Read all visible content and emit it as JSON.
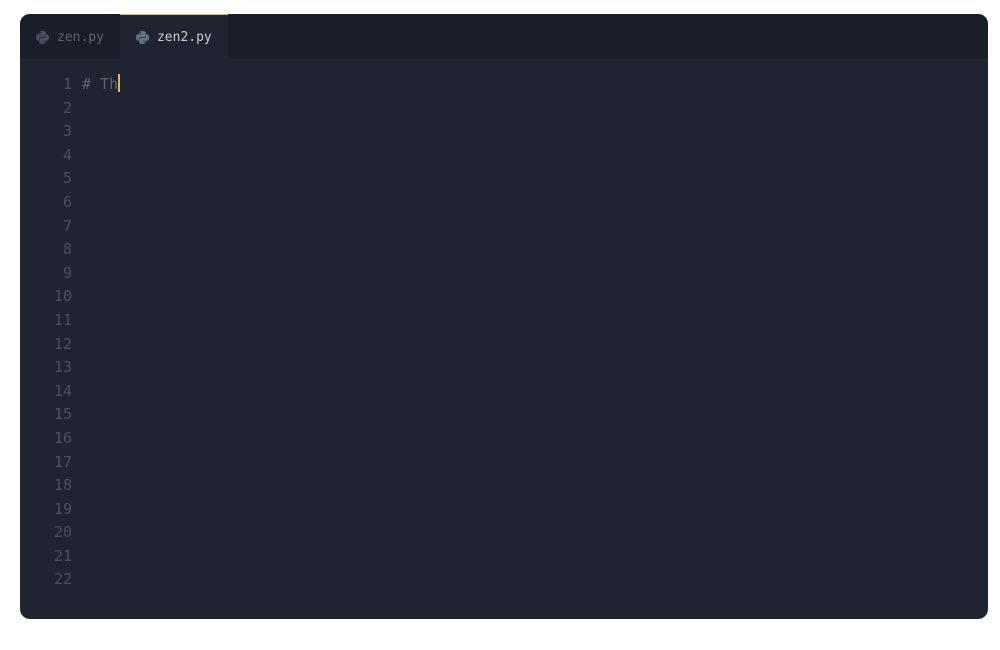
{
  "tabs": [
    {
      "label": "zen.py",
      "icon": "python-icon",
      "active": false
    },
    {
      "label": "zen2.py",
      "icon": "python-icon",
      "active": true
    }
  ],
  "editor": {
    "total_lines": 22,
    "cursor_line": 1,
    "lines": {
      "1": {
        "text": "# Th",
        "token": "comment"
      }
    }
  },
  "colors": {
    "background": "#1f2430",
    "tabbar": "#191e29",
    "accent": "#e6b450",
    "gutter_fg": "#4a505e",
    "comment_fg": "#5c6773",
    "text_fg": "#cbccc6"
  }
}
